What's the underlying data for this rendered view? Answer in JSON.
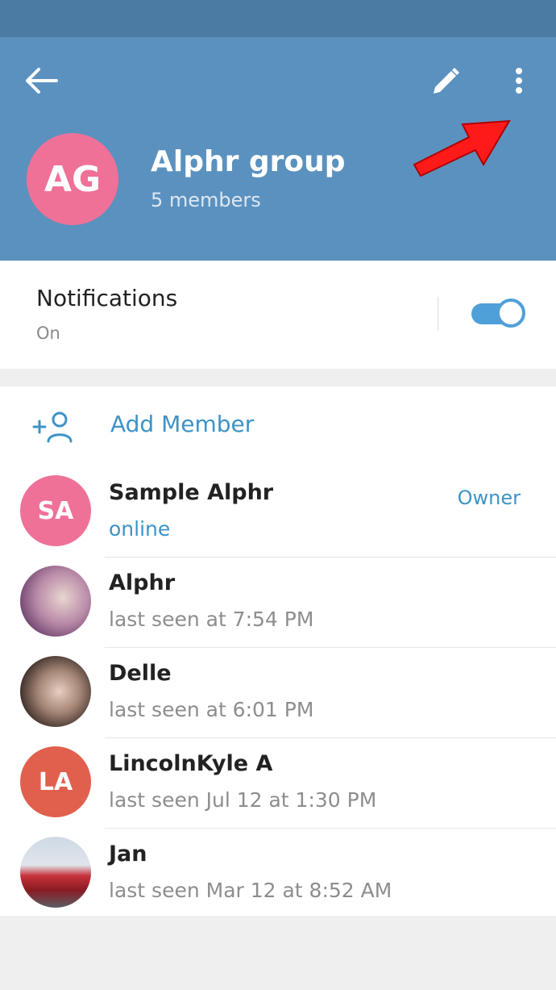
{
  "header": {
    "group_initials": "AG",
    "group_name": "Alphr group",
    "members_count": "5 members",
    "icons": [
      "arrow-left-icon",
      "pencil-icon",
      "more-vertical-icon"
    ]
  },
  "notifications": {
    "title": "Notifications",
    "state": "On",
    "enabled": true
  },
  "add_member": {
    "label": "Add Member",
    "icon": "add-user-icon"
  },
  "members": [
    {
      "initials": "SA",
      "name": "Sample Alphr",
      "status": "online",
      "role": "Owner",
      "avatar_color": "#ef7197"
    },
    {
      "initials": "",
      "name": "Alphr",
      "status": "last seen at 7:54 PM",
      "role": "",
      "avatar_color": "#b98aa8"
    },
    {
      "initials": "",
      "name": "Delle",
      "status": "last seen at 6:01 PM",
      "role": "",
      "avatar_color": "#6e5a52"
    },
    {
      "initials": "LA",
      "name": "LincolnKyle A",
      "status": "last seen Jul 12 at 1:30 PM",
      "role": "",
      "avatar_color": "#e0604d"
    },
    {
      "initials": "",
      "name": "Jan",
      "status": "last seen Mar 12 at 8:52 AM",
      "role": "",
      "avatar_color": "#c8323c"
    }
  ],
  "colors": {
    "header": "#5b91bf",
    "statusbar": "#4b7aa3",
    "accent": "#3d93c7",
    "annotation_arrow": "#ff1a1a"
  }
}
